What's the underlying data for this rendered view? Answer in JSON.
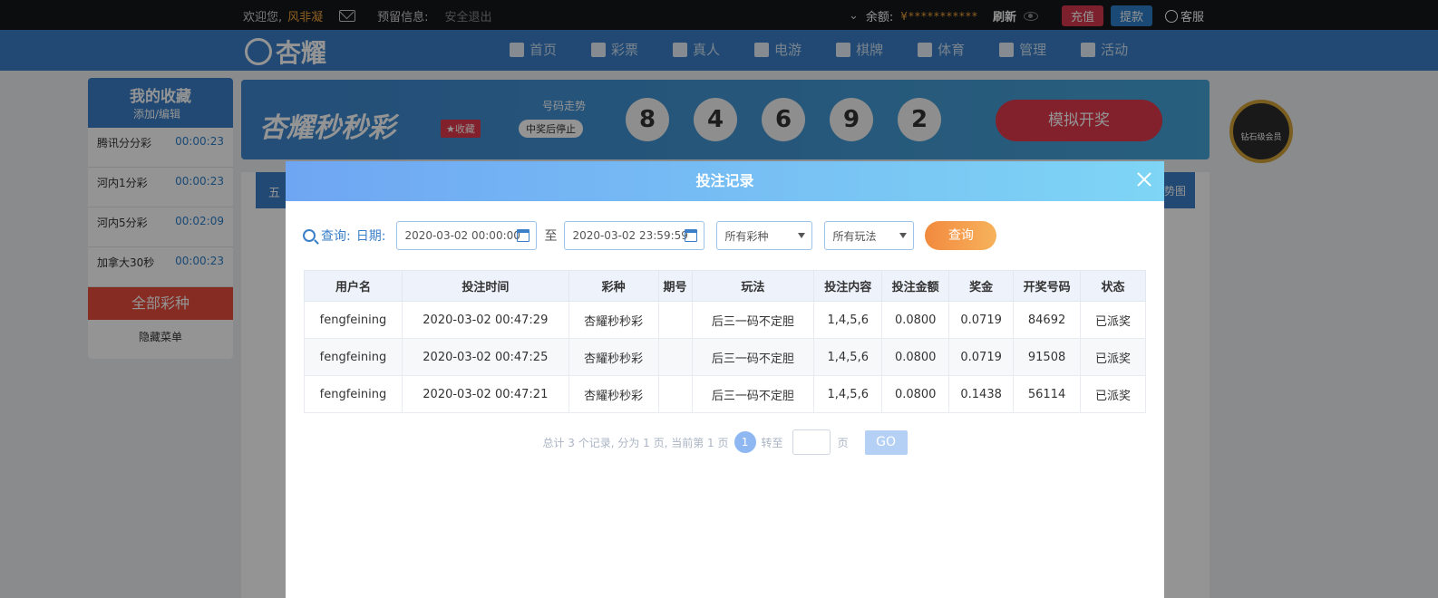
{
  "topbar": {
    "welcome": "欢迎您,",
    "username": "风非凝",
    "reserve_info": "预留信息:",
    "logout": "安全退出",
    "balance_label": "余额:",
    "balance_value": "¥***********",
    "refresh": "刷新",
    "recharge": "充值",
    "withdraw": "提款",
    "service": "客服"
  },
  "nav": {
    "logo_text": "杏耀",
    "items": [
      "首页",
      "彩票",
      "真人",
      "电游",
      "棋牌",
      "体育",
      "管理",
      "活动"
    ]
  },
  "sidebar": {
    "title": "我的收藏",
    "subtitle": "添加/编辑",
    "items": [
      {
        "name": "腾讯分分彩",
        "time": "00:00:23"
      },
      {
        "name": "河内1分彩",
        "time": "00:00:23"
      },
      {
        "name": "河内5分彩",
        "time": "00:02:09"
      },
      {
        "name": "加拿大30秒",
        "time": "00:00:23"
      }
    ],
    "all_games": "全部彩种",
    "hide_menu": "隐藏菜单"
  },
  "banner": {
    "title": "杏耀秒秒彩",
    "favorite": "★收藏",
    "trend": "号码走势",
    "stop_on_win": "中奖后停止",
    "balls": [
      "8",
      "4",
      "6",
      "9",
      "2"
    ],
    "simulate": "模拟开奖"
  },
  "main": {
    "tab_left": "五",
    "tab_right": "势图"
  },
  "badge": {
    "label": "钻石级会员"
  },
  "modal": {
    "title": "投注记录",
    "query_label": "查询:",
    "date_label": "日期:",
    "date_start": "2020-03-02 00:00:00",
    "to_label": "至",
    "date_end": "2020-03-02 23:59:59",
    "lottery_select": "所有彩种",
    "play_select": "所有玩法",
    "query_button": "查询",
    "columns": [
      "用户名",
      "投注时间",
      "彩种",
      "期号",
      "玩法",
      "投注内容",
      "投注金额",
      "奖金",
      "开奖号码",
      "状态"
    ],
    "rows": [
      [
        "fengfeining",
        "2020-03-02 00:47:29",
        "杏耀秒秒彩",
        "",
        "后三一码不定胆",
        "1,4,5,6",
        "0.0800",
        "0.0719",
        "84692",
        "已派奖"
      ],
      [
        "fengfeining",
        "2020-03-02 00:47:25",
        "杏耀秒秒彩",
        "",
        "后三一码不定胆",
        "1,4,5,6",
        "0.0800",
        "0.0719",
        "91508",
        "已派奖"
      ],
      [
        "fengfeining",
        "2020-03-02 00:47:21",
        "杏耀秒秒彩",
        "",
        "后三一码不定胆",
        "1,4,5,6",
        "0.0800",
        "0.1438",
        "56114",
        "已派奖"
      ]
    ],
    "pager": {
      "summary": "总计 3 个记录, 分为 1 页, 当前第 1 页",
      "current_page": "1",
      "goto_label": "转至",
      "page_unit": "页",
      "go": "GO"
    }
  }
}
